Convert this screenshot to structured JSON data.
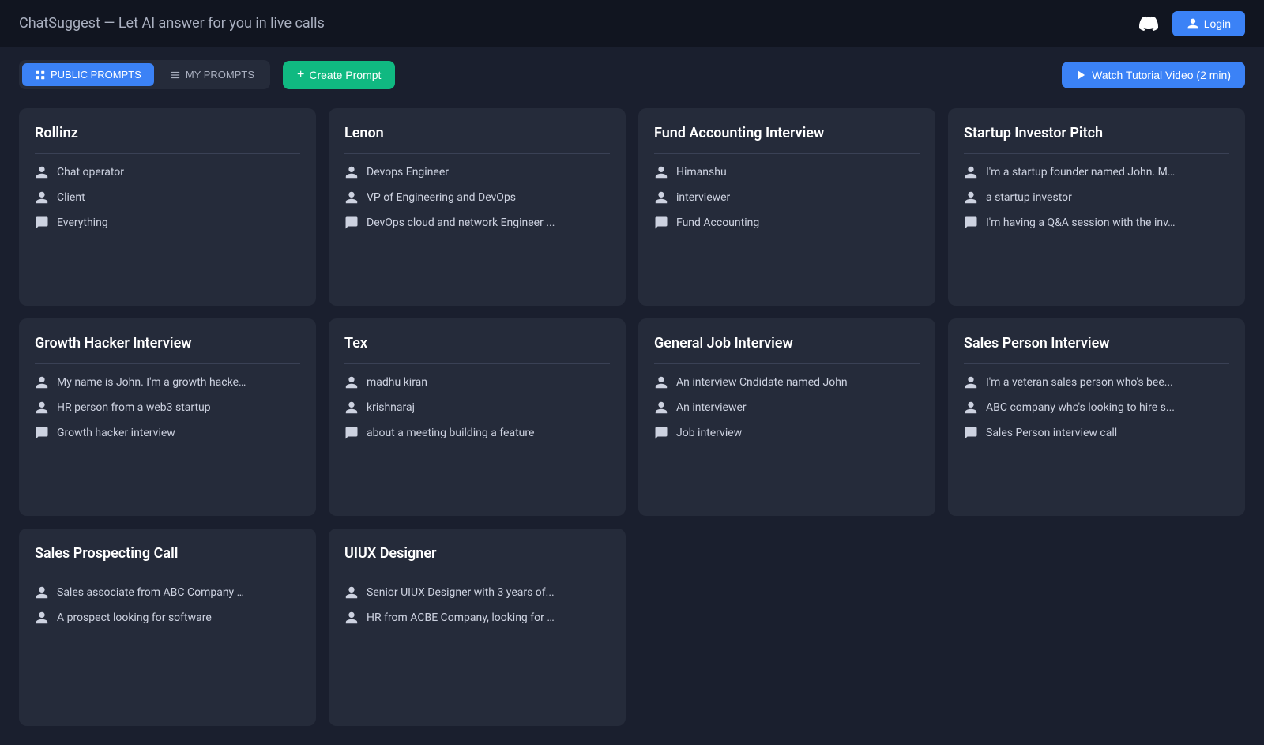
{
  "header": {
    "logo": "ChatSuggest",
    "tagline": "— Let AI answer for you in live calls",
    "login_label": "Login"
  },
  "toolbar": {
    "tab_public": "PUBLIC PROMPTS",
    "tab_my": "MY PROMPTS",
    "create_label": "Create Prompt",
    "watch_label": "Watch Tutorial Video (2 min)"
  },
  "cards": [
    {
      "title": "Rollinz",
      "rows": [
        {
          "type": "person",
          "text": "Chat operator"
        },
        {
          "type": "person",
          "text": "Client"
        },
        {
          "type": "chat",
          "text": "Everything"
        }
      ]
    },
    {
      "title": "Lenon",
      "rows": [
        {
          "type": "person",
          "text": "Devops Engineer"
        },
        {
          "type": "person",
          "text": "VP of Engineering and DevOps"
        },
        {
          "type": "chat",
          "text": "DevOps cloud and network Engineer ..."
        }
      ]
    },
    {
      "title": "Fund Accounting Interview",
      "rows": [
        {
          "type": "person",
          "text": "Himanshu"
        },
        {
          "type": "person",
          "text": "interviewer"
        },
        {
          "type": "chat",
          "text": "Fund Accounting"
        }
      ]
    },
    {
      "title": "Startup Investor Pitch",
      "rows": [
        {
          "type": "person",
          "text": "I'm a startup founder named John. M..."
        },
        {
          "type": "person",
          "text": "a startup investor"
        },
        {
          "type": "chat",
          "text": "I'm having a Q&A session with the inv..."
        }
      ]
    },
    {
      "title": "Growth Hacker Interview",
      "rows": [
        {
          "type": "person",
          "text": "My name is John. I'm a growth hacke..."
        },
        {
          "type": "person",
          "text": "HR person from a web3 startup"
        },
        {
          "type": "chat",
          "text": "Growth hacker interview"
        }
      ]
    },
    {
      "title": "Tex",
      "rows": [
        {
          "type": "person",
          "text": "madhu kiran"
        },
        {
          "type": "person",
          "text": "krishnaraj"
        },
        {
          "type": "chat",
          "text": "about a meeting building a feature"
        }
      ]
    },
    {
      "title": "General Job Interview",
      "rows": [
        {
          "type": "person",
          "text": "An interview Cndidate named John"
        },
        {
          "type": "person",
          "text": "An interviewer"
        },
        {
          "type": "chat",
          "text": "Job interview"
        }
      ]
    },
    {
      "title": "Sales Person Interview",
      "rows": [
        {
          "type": "person",
          "text": "I'm a veteran sales person who's bee..."
        },
        {
          "type": "person",
          "text": "ABC company who's looking to hire s..."
        },
        {
          "type": "chat",
          "text": "Sales Person interview call"
        }
      ]
    },
    {
      "title": "Sales Prospecting Call",
      "rows": [
        {
          "type": "person",
          "text": "Sales associate from ABC Company t..."
        },
        {
          "type": "person",
          "text": "A prospect looking for software"
        }
      ]
    },
    {
      "title": "UIUX Designer",
      "rows": [
        {
          "type": "person",
          "text": "Senior UIUX Designer with 3 years of..."
        },
        {
          "type": "person",
          "text": "HR from ACBE Company, looking for hi..."
        }
      ]
    }
  ]
}
